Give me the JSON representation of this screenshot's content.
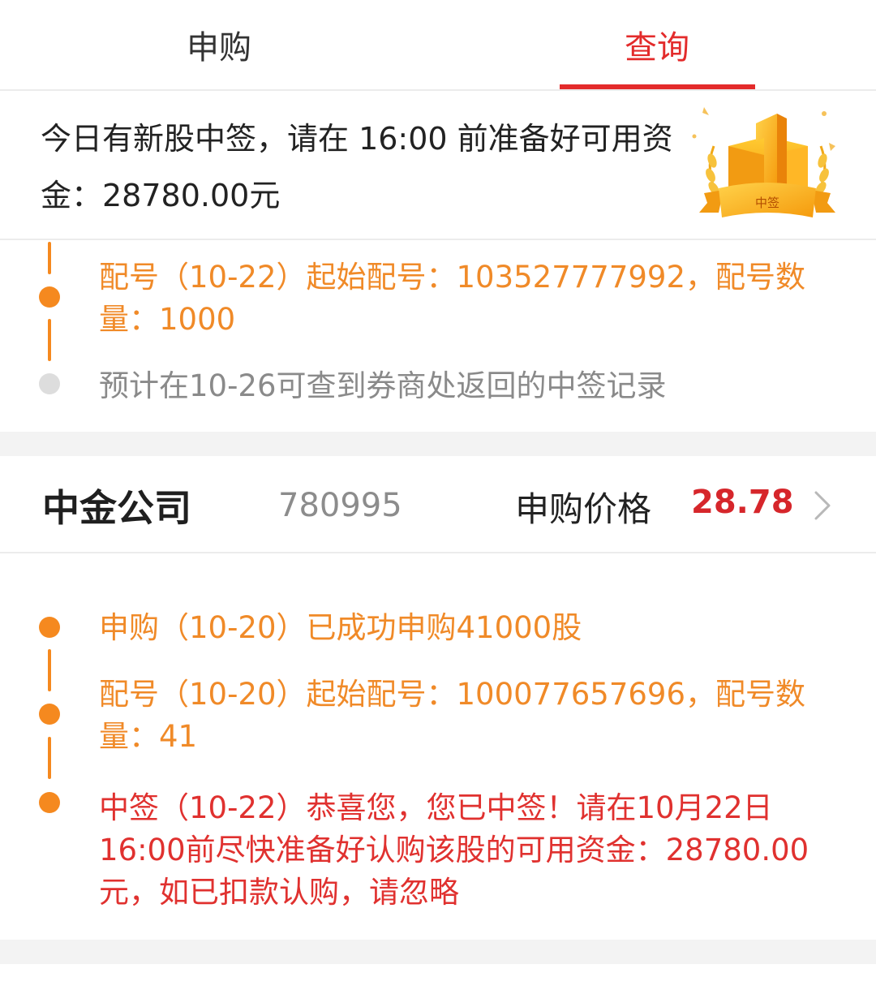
{
  "tabs": {
    "subscribe": "申购",
    "query": "查询"
  },
  "notice": {
    "text": "今日有新股中签，请在 16:00 前准备好可用资金：28780.00元",
    "badge_label": "中签"
  },
  "prev_timeline": {
    "item1": "配号（10-22）起始配号：103527777992，配号数量：1000",
    "item2": "预计在10-26可查到券商处返回的中签记录"
  },
  "stock": {
    "name": "中金公司",
    "code": "780995",
    "price_label": "申购价格",
    "price": "28.78"
  },
  "timeline": {
    "item1": "申购（10-20）已成功申购41000股",
    "item2": "配号（10-20）起始配号：100077657696，配号数量：41",
    "item3": "中签（10-22）恭喜您，您已中签！请在10月22日16:00前尽快准备好认购该股的可用资金：28780.00元，如已扣款认购，请忽略"
  },
  "colors": {
    "accent_red": "#e32b2b",
    "timeline_orange": "#f5891f",
    "price_red": "#d6262b"
  },
  "icons": {
    "badge": "gold-trophy-1-icon",
    "chevron": "chevron-right-icon"
  }
}
